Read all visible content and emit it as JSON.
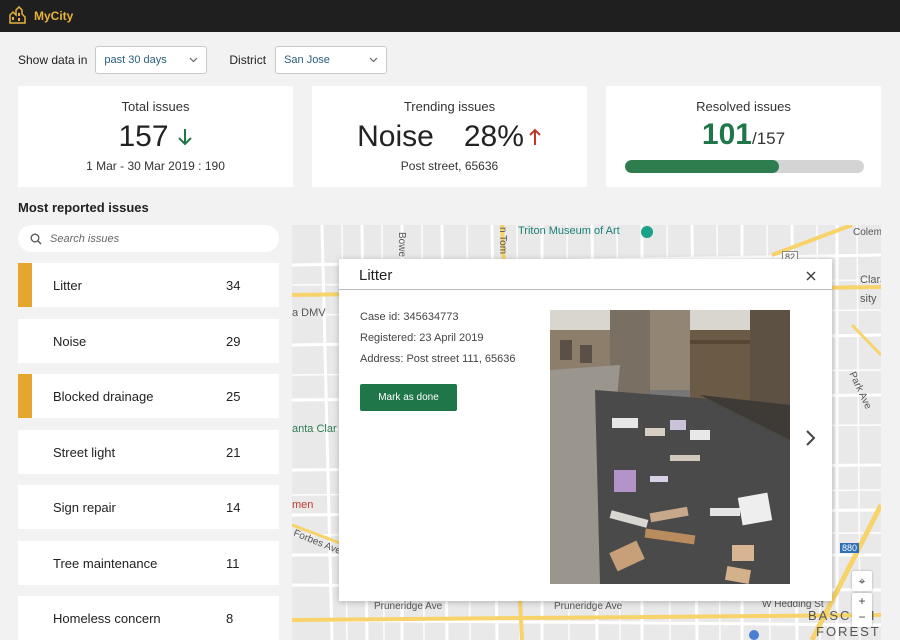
{
  "app": {
    "name": "MyCity",
    "brand_color": "#e8b33a"
  },
  "filters": {
    "show_label": "Show data in",
    "period_value": "past 30 days",
    "district_label": "District",
    "district_value": "San Jose"
  },
  "cards": {
    "total": {
      "title": "Total issues",
      "value": "157",
      "trend": "down",
      "trend_color": "#1f7648",
      "compare": "1 Mar - 30 Mar 2019 :  190"
    },
    "trending": {
      "title": "Trending issues",
      "category": "Noise",
      "percent": "28%",
      "trend": "up",
      "trend_color": "#c0392b",
      "location": "Post street, 65636"
    },
    "resolved": {
      "title": "Resolved issues",
      "value": "101",
      "total": "/157",
      "progress_fraction": 0.643,
      "bar_color": "#2e7d4f"
    }
  },
  "most_reported": {
    "title": "Most reported issues",
    "search_placeholder": "Search issues",
    "items": [
      {
        "name": "Litter",
        "count": "34",
        "flagged": true
      },
      {
        "name": "Noise",
        "count": "29",
        "flagged": false
      },
      {
        "name": "Blocked drainage",
        "count": "25",
        "flagged": true
      },
      {
        "name": "Street light",
        "count": "21",
        "flagged": false
      },
      {
        "name": "Sign repair",
        "count": "14",
        "flagged": false
      },
      {
        "name": "Tree maintenance",
        "count": "11",
        "flagged": false
      },
      {
        "name": "Homeless concern",
        "count": "8",
        "flagged": false
      }
    ]
  },
  "map": {
    "labels": {
      "triton": "Triton Museum of Art",
      "dmv": "a DMV",
      "santa_clara": "anta Clar",
      "clara": "Clara",
      "sity": "sity",
      "park_ave": "Park Ave",
      "bascom": "BASCOM",
      "forest": "FOREST",
      "forbes": "Forbes Ave",
      "pruneridge1": "Pruneridge Ave",
      "pruneridge2": "Pruneridge Ave",
      "hedding": "W Hedding St",
      "colema": "Colema",
      "men": "men",
      "bowers": "Bowe",
      "san_tomas": "n Tom",
      "route_82": "82",
      "route_880": "880"
    }
  },
  "popup": {
    "title": "Litter",
    "case_id": "Case id: 345634773",
    "registered": "Registered: 23 April 2019",
    "address": "Address: Post street 111, 65636",
    "button_label": "Mark as done"
  }
}
